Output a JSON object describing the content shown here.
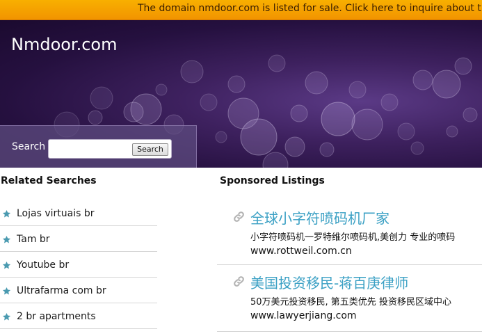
{
  "sale_banner": {
    "text": "The domain nmdoor.com is listed for sale. Click here to inquire about this"
  },
  "header": {
    "site_title": "Nmdoor.com"
  },
  "search": {
    "label": "Search",
    "input_value": "",
    "button_label": "Search"
  },
  "related": {
    "heading": "Related Searches",
    "items": [
      {
        "label": "Lojas virtuais br"
      },
      {
        "label": "Tam br"
      },
      {
        "label": "Youtube br"
      },
      {
        "label": "Ultrafarma com br"
      },
      {
        "label": "2 br apartments"
      }
    ]
  },
  "sponsored": {
    "heading": "Sponsored Listings",
    "items": [
      {
        "title": "全球小字符喷码机厂家",
        "description": "小字符喷码机一罗特维尔喷码机,美创力 专业的喷码",
        "url": "www.rottweil.com.cn"
      },
      {
        "title": "美国投资移民-蒋百庚律师",
        "description": "50万美元投资移民, 第五类优先 投资移民区域中心",
        "url": "www.lawyerjiang.com"
      }
    ]
  },
  "colors": {
    "banner": "#f5a000",
    "hero": "#2a1245",
    "link": "#3aa0c4",
    "star": "#4a9ab0"
  },
  "icons": {
    "related_item": "star-icon",
    "sponsored_item": "link-icon"
  }
}
